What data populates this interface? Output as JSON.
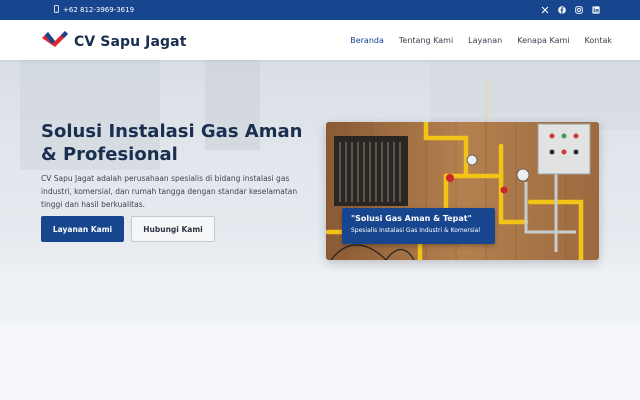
{
  "topbar": {
    "phone": "+62 812-3969-3619",
    "socials": [
      "x-icon",
      "facebook-icon",
      "instagram-icon",
      "linkedin-icon"
    ],
    "bg_color": "#17468f"
  },
  "navbar": {
    "brand": "CV Sapu Jagat",
    "items": [
      {
        "label": "Beranda",
        "active": true
      },
      {
        "label": "Tentang Kami",
        "active": false
      },
      {
        "label": "Layanan",
        "active": false
      },
      {
        "label": "Kenapa Kami",
        "active": false
      },
      {
        "label": "Kontak",
        "active": false
      }
    ]
  },
  "hero": {
    "headline": "Solusi Instalasi Gas Aman & Profesional",
    "description": "CV Sapu Jagat adalah perusahaan spesialis di bidang instalasi gas industri, komersial, dan rumah tangga dengan standar keselamatan tinggi dan hasil berkualitas.",
    "primary_button": "Layanan Kami",
    "secondary_button": "Hubungi Kami",
    "badge_title": "\"Solusi Gas Aman & Tepat\"",
    "badge_subtitle": "Spesialis Instalasi Gas Industri & Komersial"
  },
  "colors": {
    "primary": "#17468f",
    "heading": "#1a2e4f",
    "logo_red": "#e0262c"
  }
}
